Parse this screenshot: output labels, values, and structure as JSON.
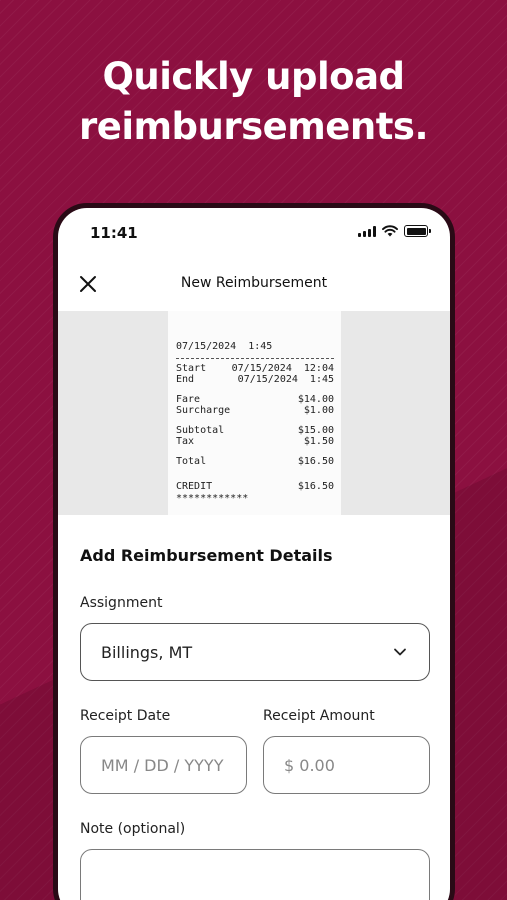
{
  "promo": {
    "headline_line1": "Quickly upload",
    "headline_line2": "reimbursements."
  },
  "status_bar": {
    "time": "11:41"
  },
  "nav": {
    "title": "New Reimbursement"
  },
  "receipt": {
    "datetime": "07/15/2024  1:45",
    "start_label": "Start",
    "start_value": "07/15/2024  12:04",
    "end_label": "End",
    "end_value": "07/15/2024  1:45",
    "fare_label": "Fare",
    "fare_value": "$14.00",
    "surcharge_label": "Surcharge",
    "surcharge_value": "$1.00",
    "subtotal_label": "Subtotal",
    "subtotal_value": "$15.00",
    "tax_label": "Tax",
    "tax_value": "$1.50",
    "total_label": "Total",
    "total_value": "$16.50",
    "credit_label": "CREDIT",
    "credit_value": "$16.50",
    "card_mask": "************"
  },
  "form": {
    "title": "Add Reimbursement Details",
    "assignment_label": "Assignment",
    "assignment_value": "Billings, MT",
    "receipt_date_label": "Receipt Date",
    "receipt_date_placeholder": "MM / DD / YYYY",
    "receipt_amount_label": "Receipt Amount",
    "receipt_amount_placeholder": "$ 0.00",
    "note_label": "Note (optional)",
    "note_value": ""
  },
  "colors": {
    "brand_background": "#8c1040",
    "field_border": "#7a7a7a"
  },
  "icons": {
    "close": "close-icon",
    "chevron": "chevron-down-icon",
    "signal": "cellular-signal-icon",
    "wifi": "wifi-icon",
    "battery": "battery-icon"
  }
}
